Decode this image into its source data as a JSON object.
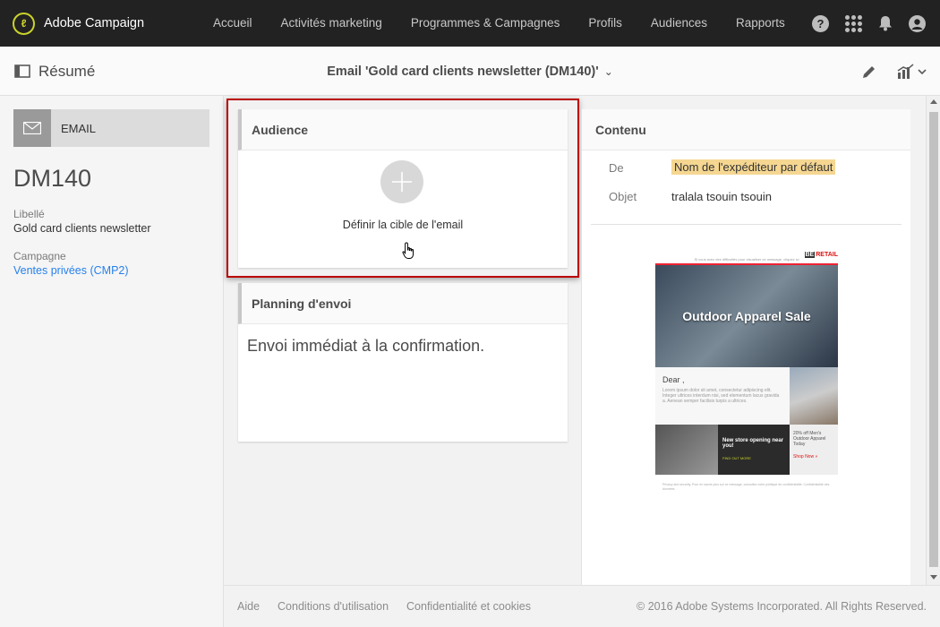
{
  "topnav": {
    "app_name": "Adobe Campaign",
    "links": [
      "Accueil",
      "Activités marketing",
      "Programmes & Campagnes",
      "Profils",
      "Audiences",
      "Rapports"
    ],
    "help_glyph": "?",
    "icons": [
      "help-icon",
      "apps-grid-icon",
      "bell-icon",
      "avatar-icon"
    ]
  },
  "subheader": {
    "summary_label": "Résumé",
    "document_title": "Email 'Gold card clients newsletter (DM140)'",
    "chevron": "⌄"
  },
  "left_panel": {
    "badge_label": "EMAIL",
    "code": "DM140",
    "label_title": "Libellé",
    "label_value": "Gold card clients newsletter",
    "campaign_title": "Campagne",
    "campaign_value": "Ventes privées (CMP2)"
  },
  "audience_card": {
    "title": "Audience",
    "action_text": "Définir la cible de l'email"
  },
  "planning_card": {
    "title": "Planning d'envoi",
    "text": "Envoi immédiat à la confirmation."
  },
  "content_panel": {
    "title": "Contenu",
    "from_label": "De",
    "from_value": "Nom de l'expéditeur par défaut",
    "subject_label": "Objet",
    "subject_value": "tralala tsouin tsouin"
  },
  "email_preview": {
    "top_text": "Si vous avez des difficultés pour visualiser ce message, cliquez ici",
    "brand": "RETAIL",
    "brand_prefix": "BE",
    "hero_title": "Outdoor Apparel Sale",
    "greeting": "Dear ,",
    "lorem": "Lorem ipsum dolor sit amet, consectetur adipiscing elit. Integer ultrices interdum nisi, sed elementum lacus gravida a. Aenean semper facilisis turpis a ultrices.",
    "promo_title": "New store opening near you!",
    "promo_link": "FIND OUT MORE",
    "offer_text": "20% off Men's Outdoor Apparel Today",
    "offer_link": "Shop Now »",
    "footer_text": "Privacy and security. Pour en savoir plus sur ce message, consultez notre politique de confidentialité. Confidentialité des données."
  },
  "footer": {
    "links": [
      "Aide",
      "Conditions d'utilisation",
      "Confidentialité et cookies"
    ],
    "copyright": "© 2016 Adobe Systems Incorporated. All Rights Reserved."
  },
  "colors": {
    "nav_bg": "#222222",
    "logo_accent": "#c9d32a",
    "highlight_border": "#bb0000",
    "sender_highlight": "#f5d792",
    "link": "#2680eb"
  }
}
